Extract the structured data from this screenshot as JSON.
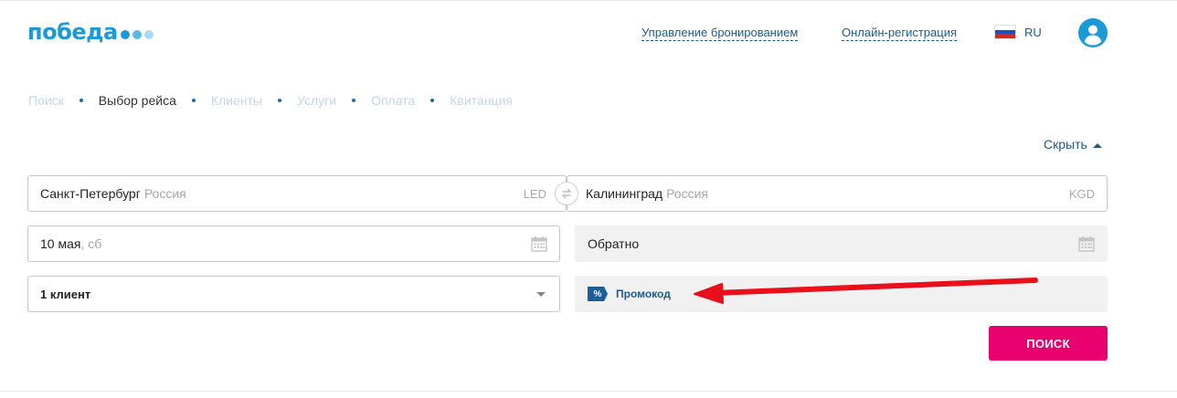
{
  "brand": {
    "logo_text": "победа",
    "colors": {
      "primary": "#1a9bd7",
      "link": "#1c5c88",
      "accent": "#e8006f",
      "dot_1": "#1a9bd7",
      "dot_2": "#5ab8e6",
      "dot_3": "#a8d8f2"
    }
  },
  "header": {
    "links": [
      {
        "label": "Управление бронированием"
      },
      {
        "label": "Онлайн-регистрация"
      }
    ],
    "language": {
      "code": "RU",
      "flag": "russia-flag"
    },
    "user_icon": "user-avatar-icon"
  },
  "steps": [
    {
      "label": "Поиск",
      "active": false
    },
    {
      "label": "Выбор рейса",
      "active": true
    },
    {
      "label": "Клиенты",
      "active": false
    },
    {
      "label": "Услуги",
      "active": false
    },
    {
      "label": "Оплата",
      "active": false
    },
    {
      "label": "Квитанция",
      "active": false
    }
  ],
  "toggle": {
    "label": "Скрыть"
  },
  "form": {
    "origin": {
      "city": "Санкт-Петербург",
      "country": "Россия",
      "code": "LED"
    },
    "destination": {
      "city": "Калининград",
      "country": "Россия",
      "code": "KGD"
    },
    "depart_date": {
      "value": "10 мая",
      "weekday": ", сб"
    },
    "return_date": {
      "placeholder": "Обратно"
    },
    "passengers": {
      "value": "1 клиент"
    },
    "promo": {
      "badge": "%",
      "label": "Промокод"
    },
    "search_label": "ПОИСК"
  },
  "annotation": {
    "color": "#e8101a",
    "icon": "red-arrow"
  }
}
